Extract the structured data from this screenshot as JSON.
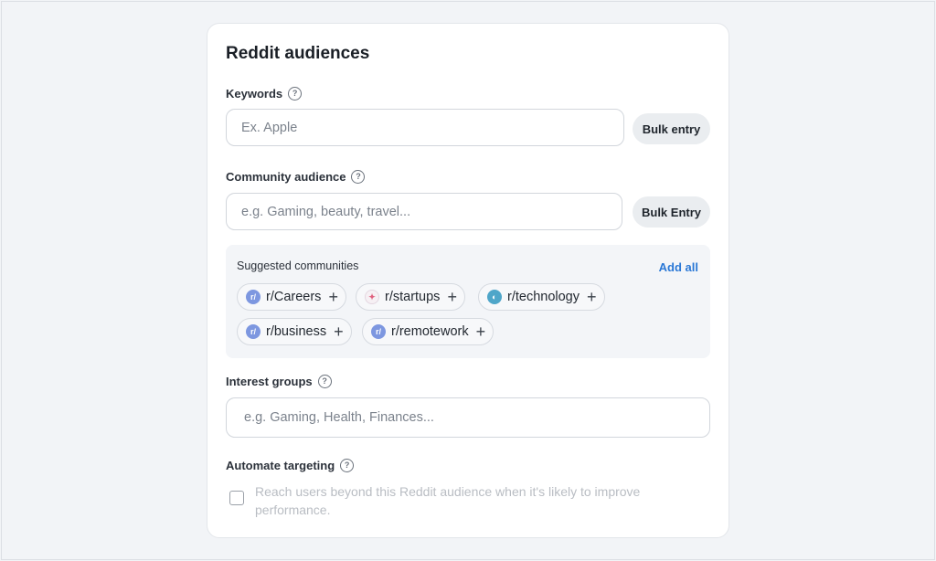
{
  "card": {
    "title": "Reddit audiences"
  },
  "keywords": {
    "label": "Keywords",
    "placeholder": "Ex. Apple",
    "bulk_label": "Bulk entry"
  },
  "community": {
    "label": "Community audience",
    "placeholder": "e.g. Gaming, beauty, travel...",
    "bulk_label": "Bulk Entry"
  },
  "suggested": {
    "title": "Suggested communities",
    "add_all": "Add all",
    "chips": [
      {
        "name": "r/Careers",
        "icon": "reddit-community-icon"
      },
      {
        "name": "r/startups",
        "icon": "startups-community-icon"
      },
      {
        "name": "r/technology",
        "icon": "technology-community-icon"
      },
      {
        "name": "r/business",
        "icon": "reddit-community-icon"
      },
      {
        "name": "r/remotework",
        "icon": "reddit-community-icon"
      }
    ]
  },
  "interest": {
    "label": "Interest groups",
    "placeholder": "e.g. Gaming, Health, Finances..."
  },
  "automate": {
    "label": "Automate targeting",
    "checkbox_text": "Reach users beyond this Reddit audience when it's likely to improve performance."
  },
  "colors": {
    "accent": "#2a78d6",
    "page_bg": "#f2f4f7",
    "card_bg": "#ffffff"
  }
}
